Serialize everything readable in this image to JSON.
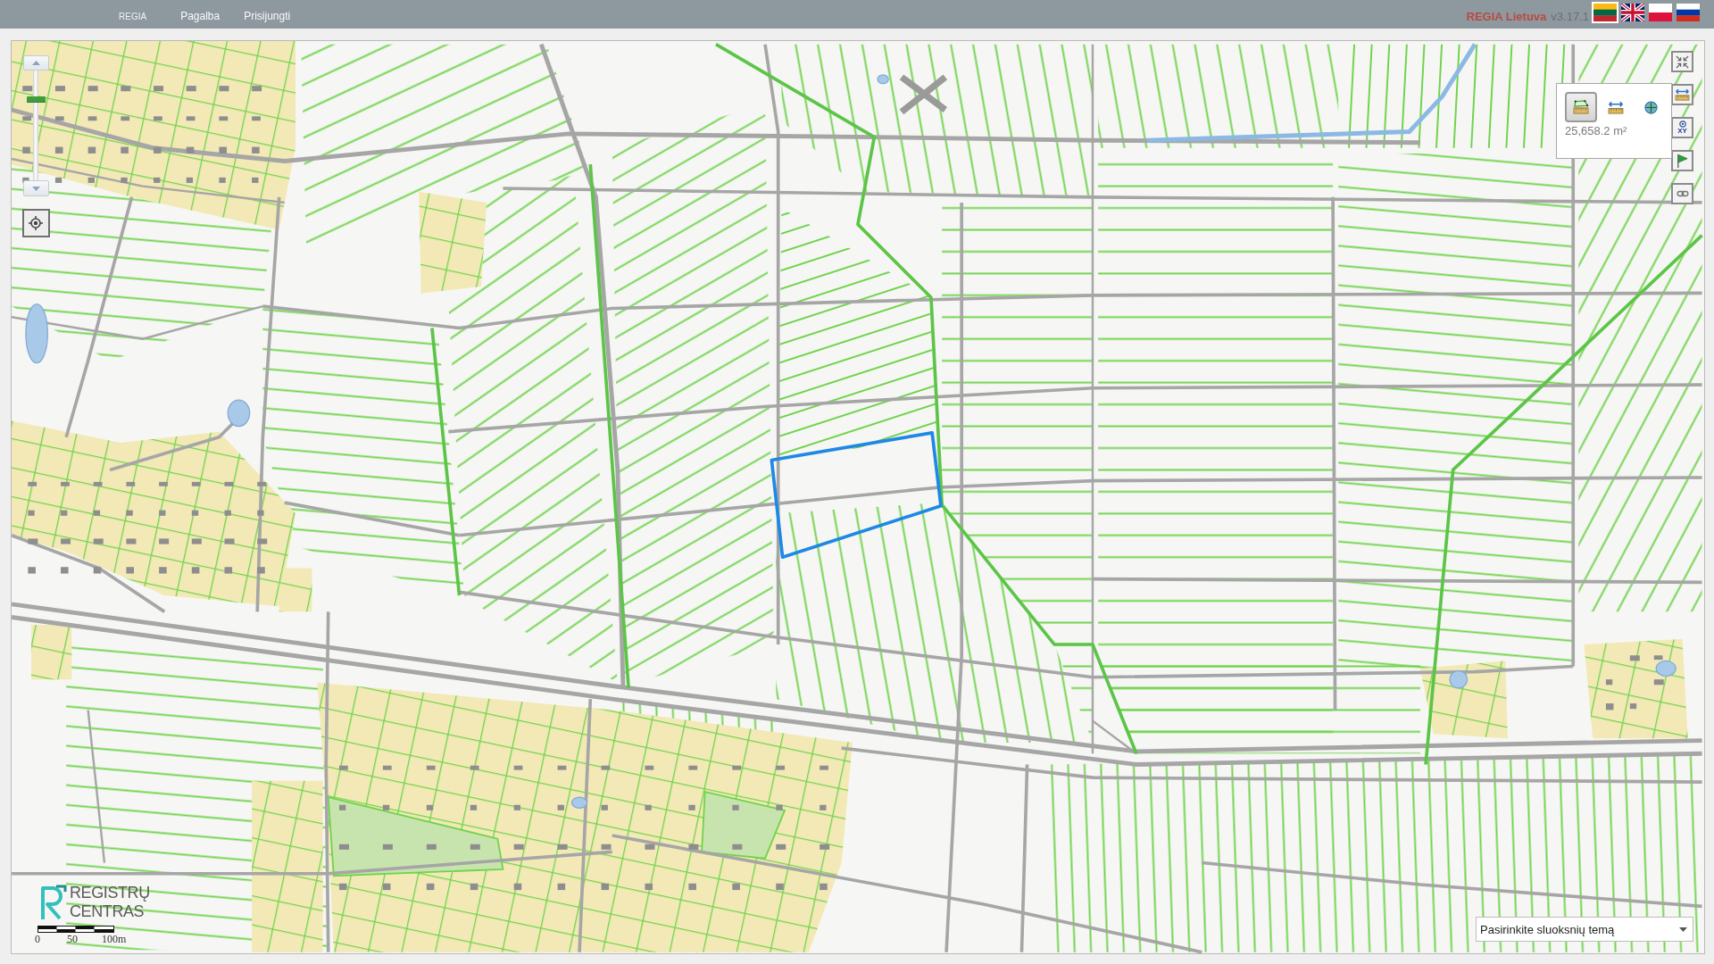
{
  "header": {
    "app_name": "REGIA",
    "menu": [
      {
        "label": "Pagalba"
      },
      {
        "label": "Prisijungti"
      }
    ],
    "product": "REGIA Lietuva",
    "version": "v3.17.1",
    "languages": [
      {
        "kind": "lt",
        "selected": true
      },
      {
        "kind": "en",
        "selected": false
      },
      {
        "kind": "pl",
        "selected": false
      },
      {
        "kind": "ru",
        "selected": false
      }
    ]
  },
  "map": {
    "zoom": {
      "level": 0.75
    },
    "toolbar": [
      {
        "kind": "fullscreen"
      },
      {
        "kind": "measure"
      },
      {
        "kind": "coordinates",
        "label": "XY"
      },
      {
        "kind": "marker"
      },
      {
        "kind": "link"
      }
    ],
    "measure_panel": {
      "tools": [
        {
          "kind": "area",
          "selected": true
        },
        {
          "kind": "distance",
          "selected": false
        },
        {
          "kind": "point",
          "selected": false
        }
      ],
      "result": "25,658.2 m²"
    },
    "logo": {
      "text": "REGISTRŲ CENTRAS"
    },
    "scale_bar": {
      "labels": [
        "0",
        "50",
        "100m"
      ]
    },
    "layer_select": {
      "label": "Pasirinkite sluoksnių temą"
    }
  }
}
